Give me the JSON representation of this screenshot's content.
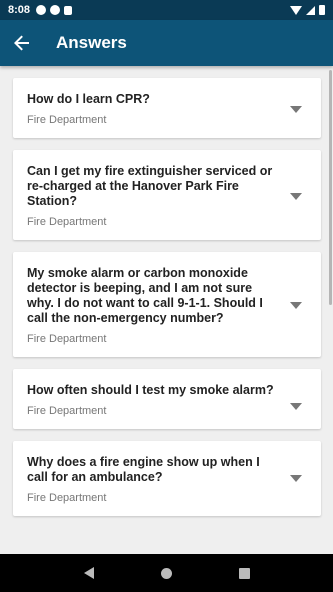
{
  "status": {
    "time": "8:08"
  },
  "header": {
    "title": "Answers",
    "back_icon": "arrow-left-icon"
  },
  "faqs": [
    {
      "question": "How do I learn CPR?",
      "department": "Fire Department"
    },
    {
      "question": "Can I get my fire extinguisher serviced or re-charged at the Hanover Park Fire Station?",
      "department": "Fire Department"
    },
    {
      "question": "My smoke alarm or carbon monoxide detector is beeping, and I am not sure why.  I do not want to call 9-1-1. Should I call the non-emergency number?",
      "department": "Fire Department"
    },
    {
      "question": "How often should I test my smoke alarm?",
      "department": "Fire Department"
    },
    {
      "question": "Why does a fire engine show up when I call for an ambulance?",
      "department": "Fire Department"
    }
  ],
  "colors": {
    "app_bar": "#0d5478",
    "status_bar": "#0a3a55",
    "background": "#efefef"
  }
}
